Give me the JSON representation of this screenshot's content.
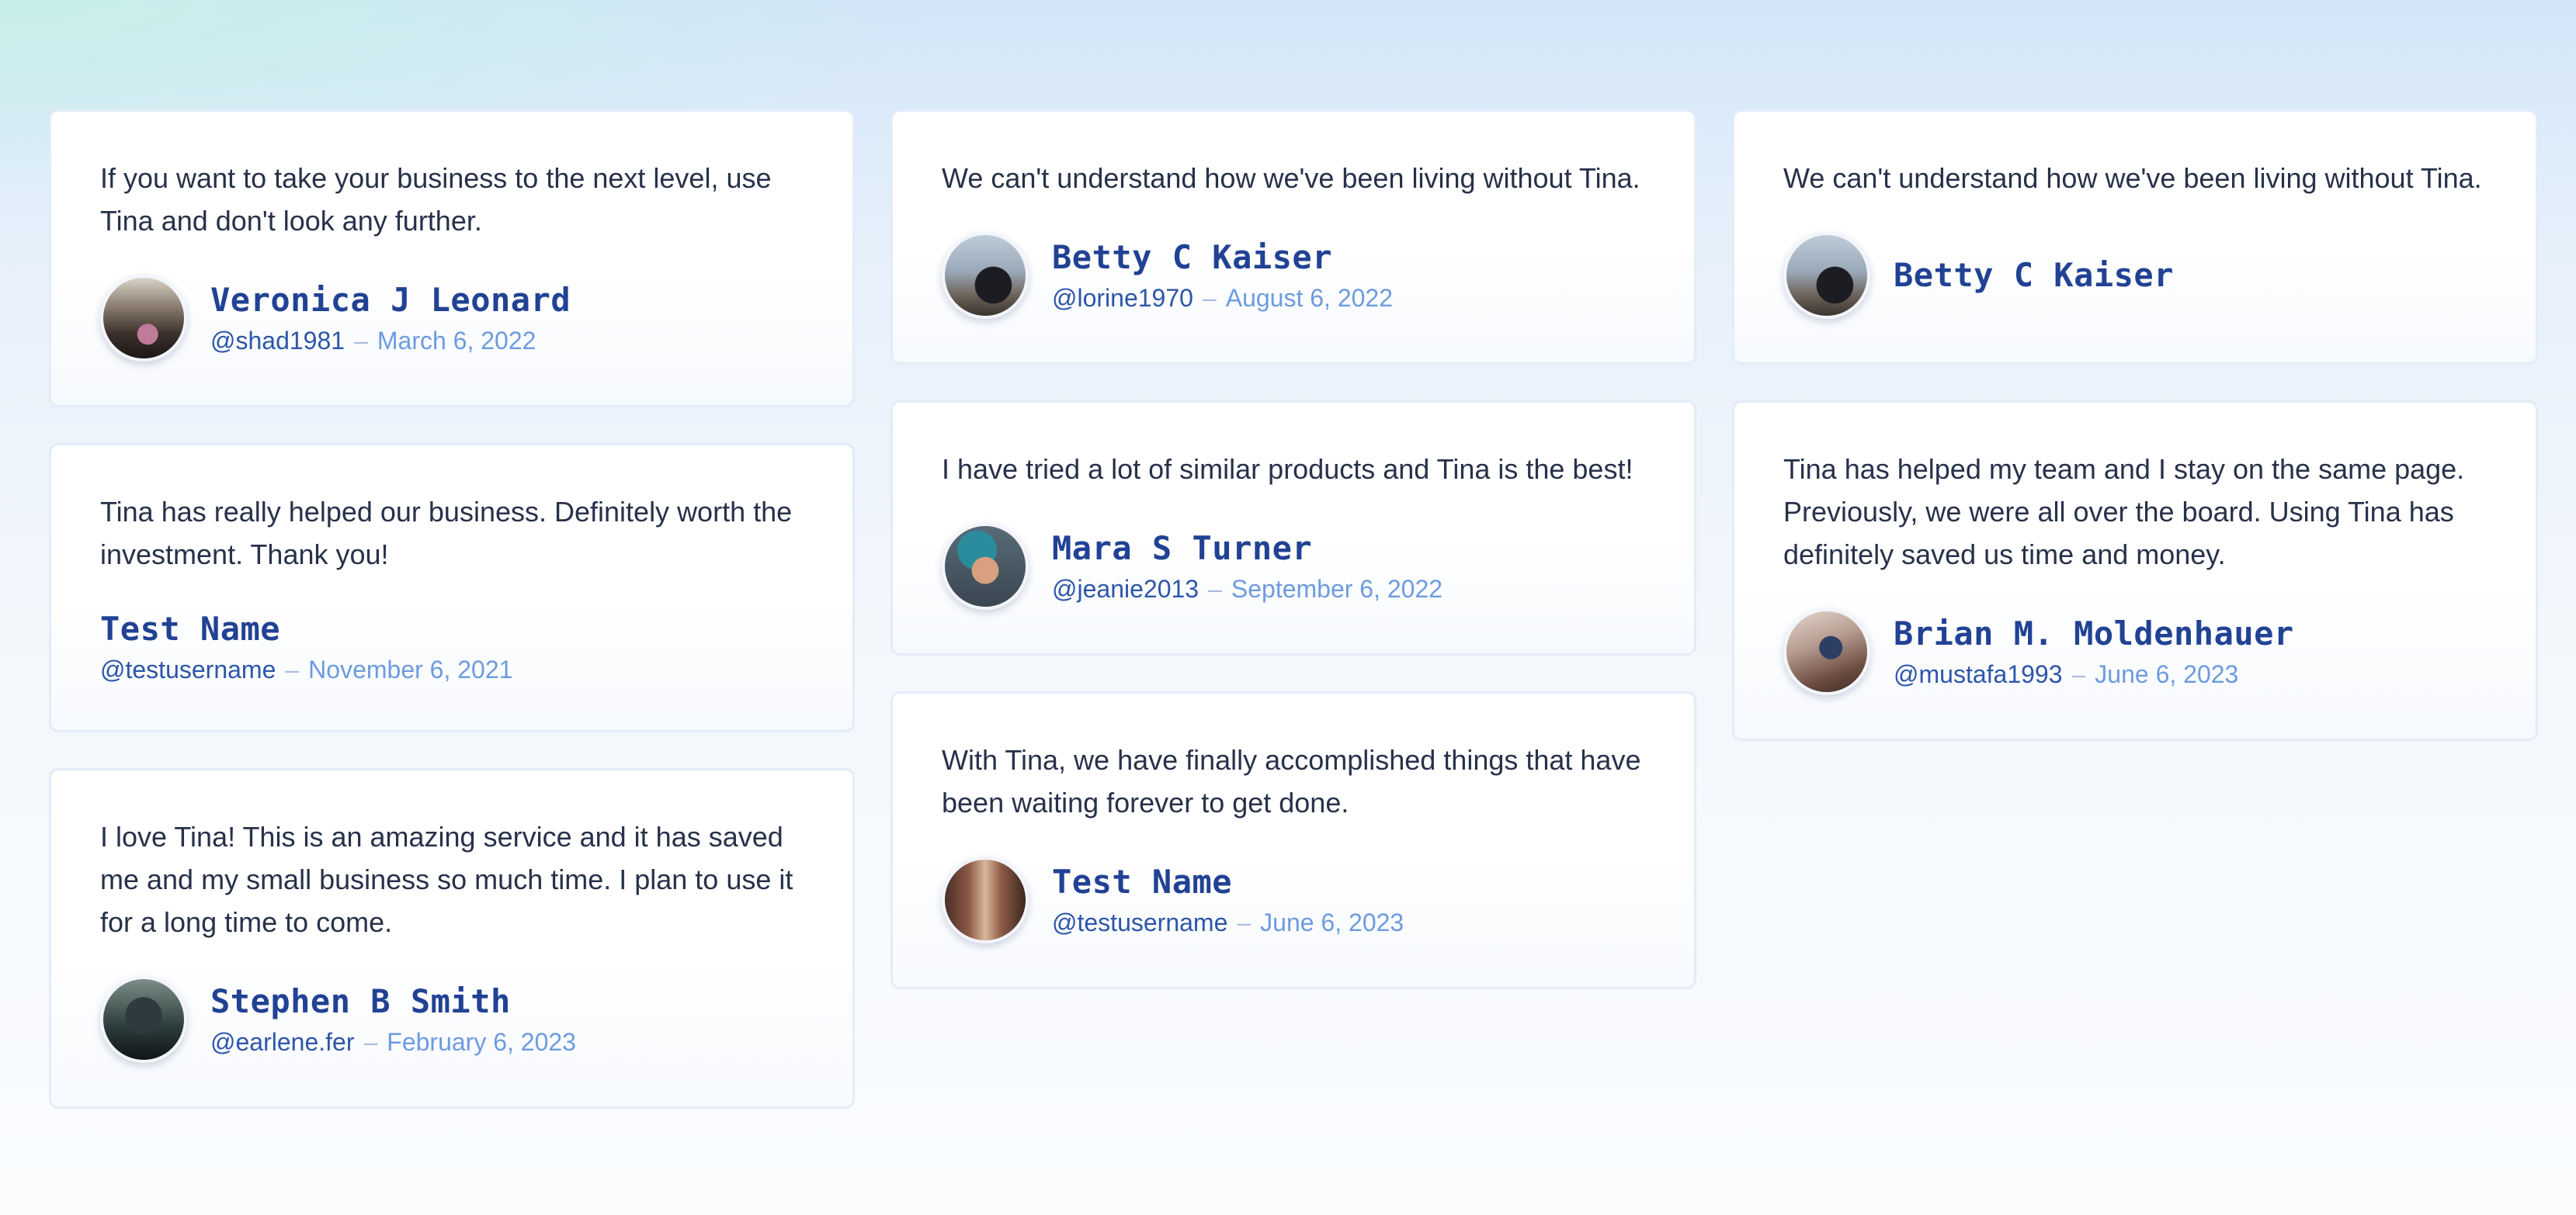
{
  "testimonials": [
    {
      "quote": "If you want to take your business to the next level, use Tina and don't look any further.",
      "name": "Veronica J Leonard",
      "handle": "@shad1981",
      "separator": "–",
      "date": "March 6, 2022"
    },
    {
      "quote": "Tina has really helped our business. Definitely worth the investment. Thank you!",
      "name": "Test Name",
      "handle": "@testusername",
      "separator": "–",
      "date": "November 6, 2021"
    },
    {
      "quote": "I love Tina! This is an amazing service and it has saved me and my small business so much time. I plan to use it for a long time to come.",
      "name": "Stephen B Smith",
      "handle": "@earlene.fer",
      "separator": "–",
      "date": "February 6, 2023"
    },
    {
      "quote": "We can't understand how we've been living without Tina.",
      "name": "Betty C Kaiser",
      "handle": "@lorine1970",
      "separator": "–",
      "date": "August 6, 2022"
    },
    {
      "quote": "I have tried a lot of similar products and Tina is the best!",
      "name": "Mara S Turner",
      "handle": "@jeanie2013",
      "separator": "–",
      "date": "September 6, 2022"
    },
    {
      "quote": "With Tina, we have finally accomplished things that have been waiting forever to get done.",
      "name": "Test Name",
      "handle": "@testusername",
      "separator": "–",
      "date": "June 6, 2023"
    },
    {
      "quote": "We can't understand how we've been living without Tina.",
      "name": "Betty C Kaiser"
    },
    {
      "quote": "Tina has helped my team and I stay on the same page. Previously, we were all over the board. Using Tina has definitely saved us time and money.",
      "name": "Brian M. Moldenhauer",
      "handle": "@mustafa1993",
      "separator": "–",
      "date": "June 6, 2023"
    }
  ]
}
